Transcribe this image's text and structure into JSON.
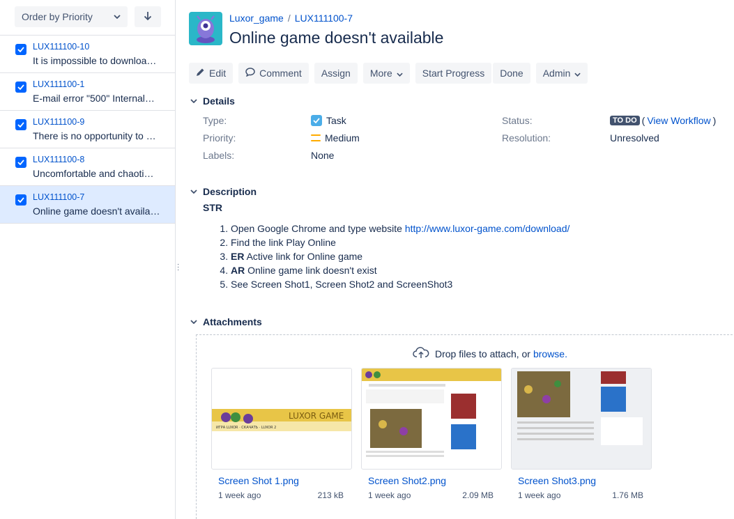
{
  "sort": {
    "label": "Order by Priority"
  },
  "issues": [
    {
      "key": "LUX111100-10",
      "summary": "It is impossible to downloa…"
    },
    {
      "key": "LUX111100-1",
      "summary": "E-mail error \"500\" Internal…"
    },
    {
      "key": "LUX111100-9",
      "summary": "There is no opportunity to …"
    },
    {
      "key": "LUX111100-8",
      "summary": "Uncomfortable and chaoti…"
    },
    {
      "key": "LUX111100-7",
      "summary": "Online game doesn't availa…"
    }
  ],
  "breadcrumb": {
    "project": "Luxor_game",
    "separator": "/",
    "issue_key": "LUX111100-7"
  },
  "issue_title": "Online game doesn't available",
  "toolbar": {
    "edit": "Edit",
    "comment": "Comment",
    "assign": "Assign",
    "more": "More",
    "start_progress": "Start Progress",
    "done": "Done",
    "admin": "Admin"
  },
  "details": {
    "heading": "Details",
    "type_label": "Type:",
    "type_value": "Task",
    "priority_label": "Priority:",
    "priority_value": "Medium",
    "labels_label": "Labels:",
    "labels_value": "None",
    "status_label": "Status:",
    "status_value": "TO DO",
    "view_workflow": "View Workflow",
    "resolution_label": "Resolution:",
    "resolution_value": "Unresolved"
  },
  "description": {
    "heading": "Description",
    "str": "STR",
    "steps": [
      {
        "prefix": "",
        "text": "Open Google Chrome and type website ",
        "link": "http://www.luxor-game.com/download/"
      },
      {
        "prefix": "",
        "text": "Find the link Play Online",
        "link": ""
      },
      {
        "prefix": "ER",
        "text": " Active link for Online game",
        "link": ""
      },
      {
        "prefix": "AR",
        "text": " Online game link doesn't exist",
        "link": ""
      },
      {
        "prefix": "",
        "text": "See Screen Shot1, Screen Shot2 and ScreenShot3",
        "link": ""
      }
    ]
  },
  "attachments": {
    "heading": "Attachments",
    "drop_text": "Drop files to attach, or",
    "browse": "browse.",
    "files": [
      {
        "name": "Screen Shot 1.png",
        "date": "1 week ago",
        "size": "213 kB"
      },
      {
        "name": "Screen Shot2.png",
        "date": "1 week ago",
        "size": "2.09 MB"
      },
      {
        "name": "Screen Shot3.png",
        "date": "1 week ago",
        "size": "1.76 MB"
      }
    ]
  },
  "colors": {
    "link": "#0052cc",
    "selected_bg": "#deebff",
    "checkbox": "#0065ff",
    "avatar": "#2ab7c8"
  }
}
